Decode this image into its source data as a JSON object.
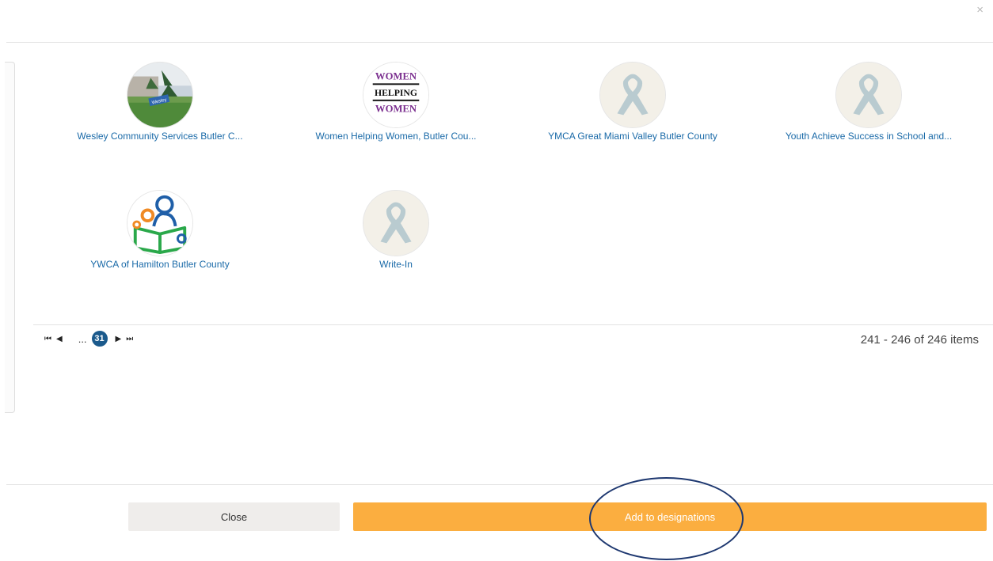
{
  "dialog": {
    "close_glyph": "×"
  },
  "tiles": [
    {
      "name": "Wesley Community Services Butler C...",
      "image": "photo"
    },
    {
      "name": "Women Helping Women, Butler Cou...",
      "image": "women-helping-women-logo"
    },
    {
      "name": "YMCA Great Miami Valley Butler County",
      "image": "ribbon-icon"
    },
    {
      "name": "Youth Achieve Success in School and...",
      "image": "ribbon-icon"
    },
    {
      "name": "YWCA of Hamilton Butler County",
      "image": "reading-family-logo"
    },
    {
      "name": "Write-In",
      "image": "ribbon-icon"
    }
  ],
  "logo_text": {
    "line1": "WOMEN",
    "line2": "HELPING",
    "line3": "WOMEN",
    "photo_sign": "Wesley"
  },
  "pager": {
    "first_icon": "⏮",
    "prev_icon": "◀",
    "ellipsis": "...",
    "current_page": "31",
    "next_icon": "▶",
    "last_icon": "⏭",
    "info": "241 - 246 of 246 items"
  },
  "footer": {
    "close_label": "Close",
    "add_label": "Add to designations"
  },
  "colors": {
    "link": "#1a6aa8",
    "accent_orange": "#fbae40",
    "pager_active": "#1b5a8c",
    "annotation": "#1e3870"
  }
}
